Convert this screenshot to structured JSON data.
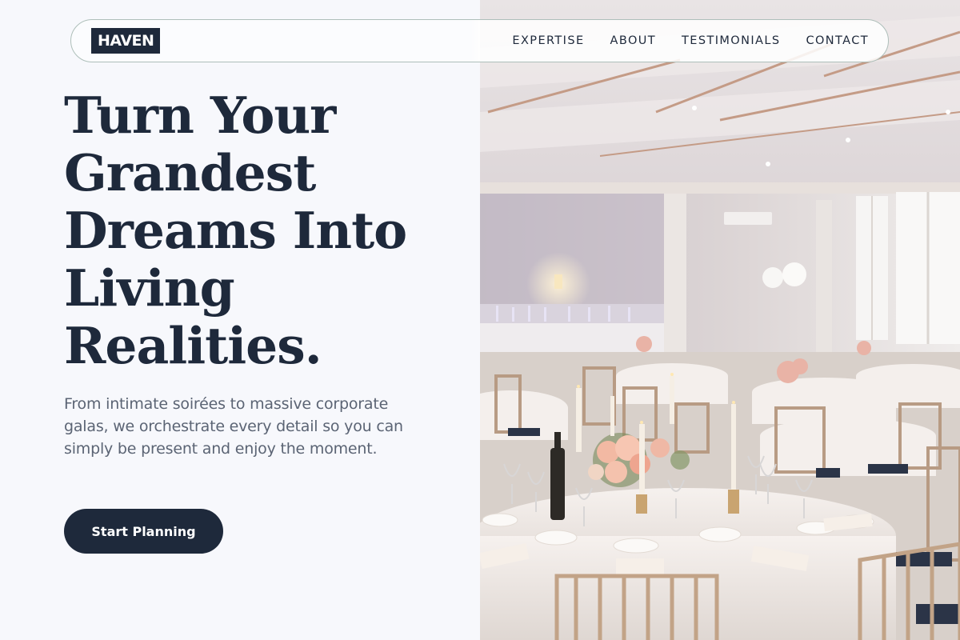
{
  "brand": {
    "logo_text": "HAVEN"
  },
  "nav": {
    "links": [
      {
        "label": "EXPERTISE"
      },
      {
        "label": "ABOUT"
      },
      {
        "label": "TESTIMONIALS"
      },
      {
        "label": "CONTACT"
      }
    ]
  },
  "hero": {
    "title": "Turn Your Grandest Dreams Into Living Realities.",
    "description": "From intimate soirées to massive corporate galas, we orchestrate every detail so you can simply be present and enjoy the moment.",
    "cta_label": "Start Planning"
  },
  "colors": {
    "navy": "#1e293b",
    "page_background": "#f7f8fc",
    "muted_text": "#5b6474"
  },
  "image": {
    "icon": "banquet-hall-photo"
  }
}
